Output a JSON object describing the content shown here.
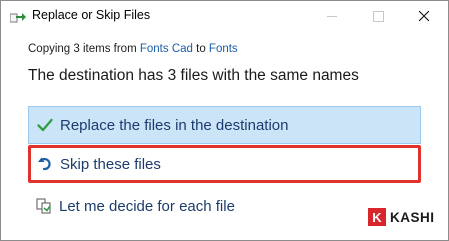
{
  "window": {
    "title": "Replace or Skip Files",
    "title_icon": "file-move-icon",
    "close_glyph": "✕"
  },
  "copying": {
    "prefix": "Copying 3 items from",
    "source": "Fonts Cad",
    "to": "to",
    "destination": "Fonts"
  },
  "heading": "The destination has 3 files with the same names",
  "options": {
    "replace": {
      "label": "Replace the files in the destination",
      "icon": "checkmark-icon",
      "selected": true
    },
    "skip": {
      "label": "Skip these files",
      "icon": "skip-arrow-icon",
      "highlighted": true
    },
    "decide": {
      "label": "Let me decide for each file",
      "icon": "compare-files-icon"
    }
  },
  "brand": {
    "letter": "K",
    "text": "KASHI"
  },
  "colors": {
    "link": "#1a5ea8",
    "option_text": "#1c3c6e",
    "selected_bg": "#cce4f7",
    "highlight_border": "#e0332d",
    "check": "#2f9e44"
  }
}
